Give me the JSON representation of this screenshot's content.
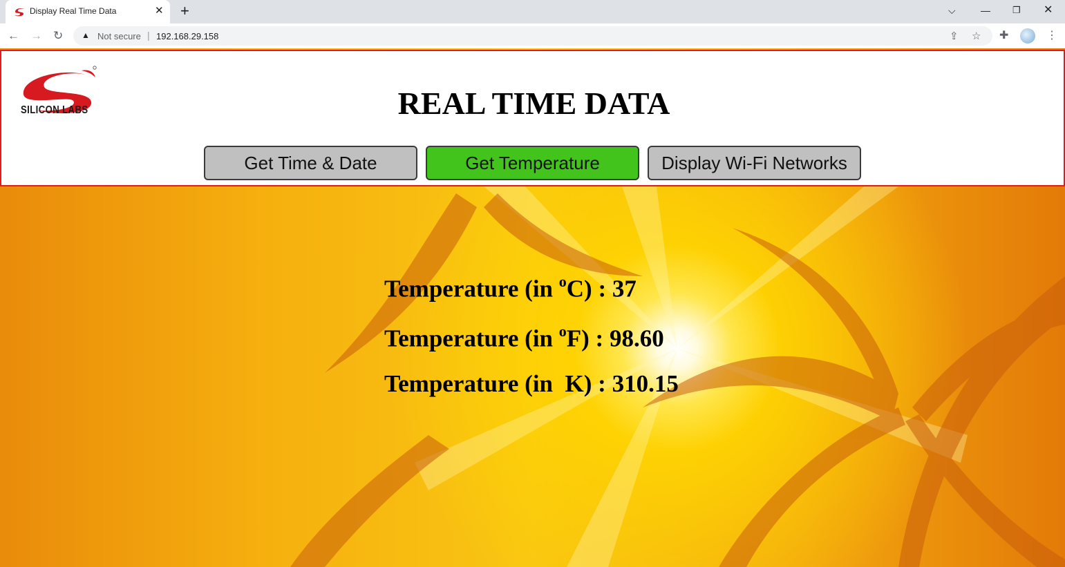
{
  "browser": {
    "tab_title": "Display Real Time Data",
    "tab_close_icon": "close-icon",
    "new_tab_icon": "plus-icon",
    "security_label": "Not secure",
    "url": "192.168.29.158"
  },
  "page": {
    "logo_text": "SILICON LABS",
    "title": "REAL TIME DATA",
    "buttons": [
      {
        "label": "Get Time & Date",
        "active": false
      },
      {
        "label": "Get Temperature",
        "active": true
      },
      {
        "label": "Display Wi-Fi Networks",
        "active": false
      }
    ],
    "temperature": {
      "celsius_prefix": "Temperature (in ",
      "celsius_unit_sup": "o",
      "celsius_unit": "C) : ",
      "celsius_value": "37",
      "fahrenheit_prefix": "Temperature (in ",
      "fahrenheit_unit_sup": "o",
      "fahrenheit_unit": "F) : ",
      "fahrenheit_value": "98.60",
      "kelvin_prefix": "Temperature (in  ",
      "kelvin_unit": "K) : ",
      "kelvin_value": "310.15"
    }
  },
  "colors": {
    "active_button": "#43c41d",
    "inactive_button": "#c0c0c0",
    "header_border": "#e11b1b",
    "logo_red": "#d71920"
  }
}
